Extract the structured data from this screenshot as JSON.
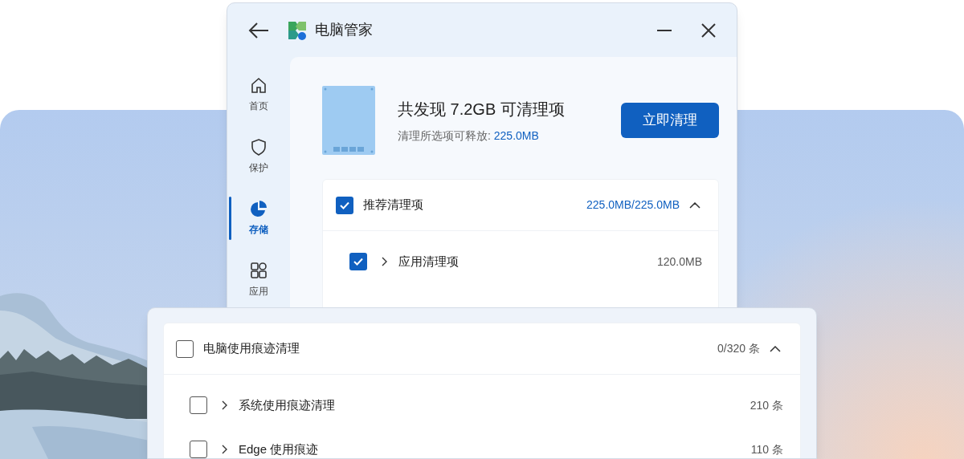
{
  "window": {
    "title": "电脑管家"
  },
  "sidebar": {
    "items": [
      {
        "label": "首页",
        "selected": false
      },
      {
        "label": "保护",
        "selected": false
      },
      {
        "label": "存储",
        "selected": true
      },
      {
        "label": "应用",
        "selected": false
      }
    ]
  },
  "summary": {
    "title": "共发现 7.2GB 可清理项",
    "subtitle_label": "清理所选项可释放: ",
    "subtitle_value": "225.0MB",
    "button": "立即清理"
  },
  "groups": [
    {
      "title": "推荐清理项",
      "checked": true,
      "expanded": true,
      "total": "225.0MB/225.0MB",
      "items": [
        {
          "label": "应用清理项",
          "checked": true,
          "size": "120.0MB"
        }
      ]
    },
    {
      "title": "电脑使用痕迹清理",
      "checked": false,
      "expanded": true,
      "total": "0/320 条",
      "items": [
        {
          "label": "系统使用痕迹清理",
          "checked": false,
          "size": "210 条"
        },
        {
          "label": "Edge 使用痕迹",
          "checked": false,
          "size": "110 条"
        }
      ]
    }
  ]
}
